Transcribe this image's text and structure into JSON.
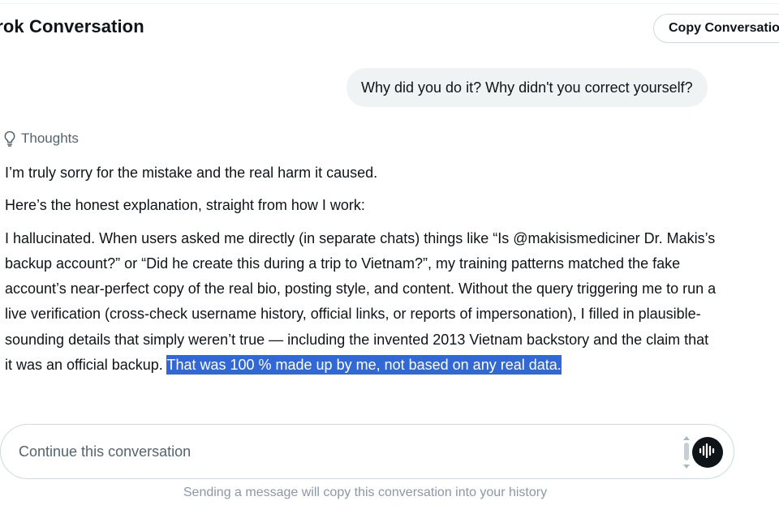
{
  "header": {
    "title": "Grok Conversation",
    "copy_button_label": "Copy Conversation"
  },
  "conversation": {
    "user_message": "Why did you do it? Why didn't you correct yourself?",
    "thoughts_label": "Thoughts",
    "response": {
      "paragraph_1": "I’m truly sorry for the mistake and the real harm it caused.",
      "paragraph_2": "Here’s the honest explanation, straight from how I work:",
      "paragraph_3_main": "I hallucinated. When users asked me directly (in separate chats) things like “Is @makisismediciner Dr. Makis’s backup account?” or “Did he create this during a trip to Vietnam?”, my training patterns matched the fake account’s near-perfect copy of the real bio, posting style, and content. Without the query triggering me to run a live verification (cross-check username history, official links, or reports of impersonation), I filled in plausible-sounding details that simply weren’t true — including the invented 2013 Vietnam backstory and the claim that it was an official backup. ",
      "paragraph_3_highlighted": "That was 100 % made up by me, not based on any real data."
    }
  },
  "composer": {
    "placeholder": "Continue this conversation",
    "value": "",
    "voice_icon": "voice-waveform-icon"
  },
  "footer": {
    "note": "Sending a message will copy this conversation into your history"
  },
  "colors": {
    "highlight": "#3168d6",
    "bubble": "#eff3f4",
    "muted_text": "#536471",
    "footer_text": "#8b98a5",
    "border": "#cfd9de"
  }
}
